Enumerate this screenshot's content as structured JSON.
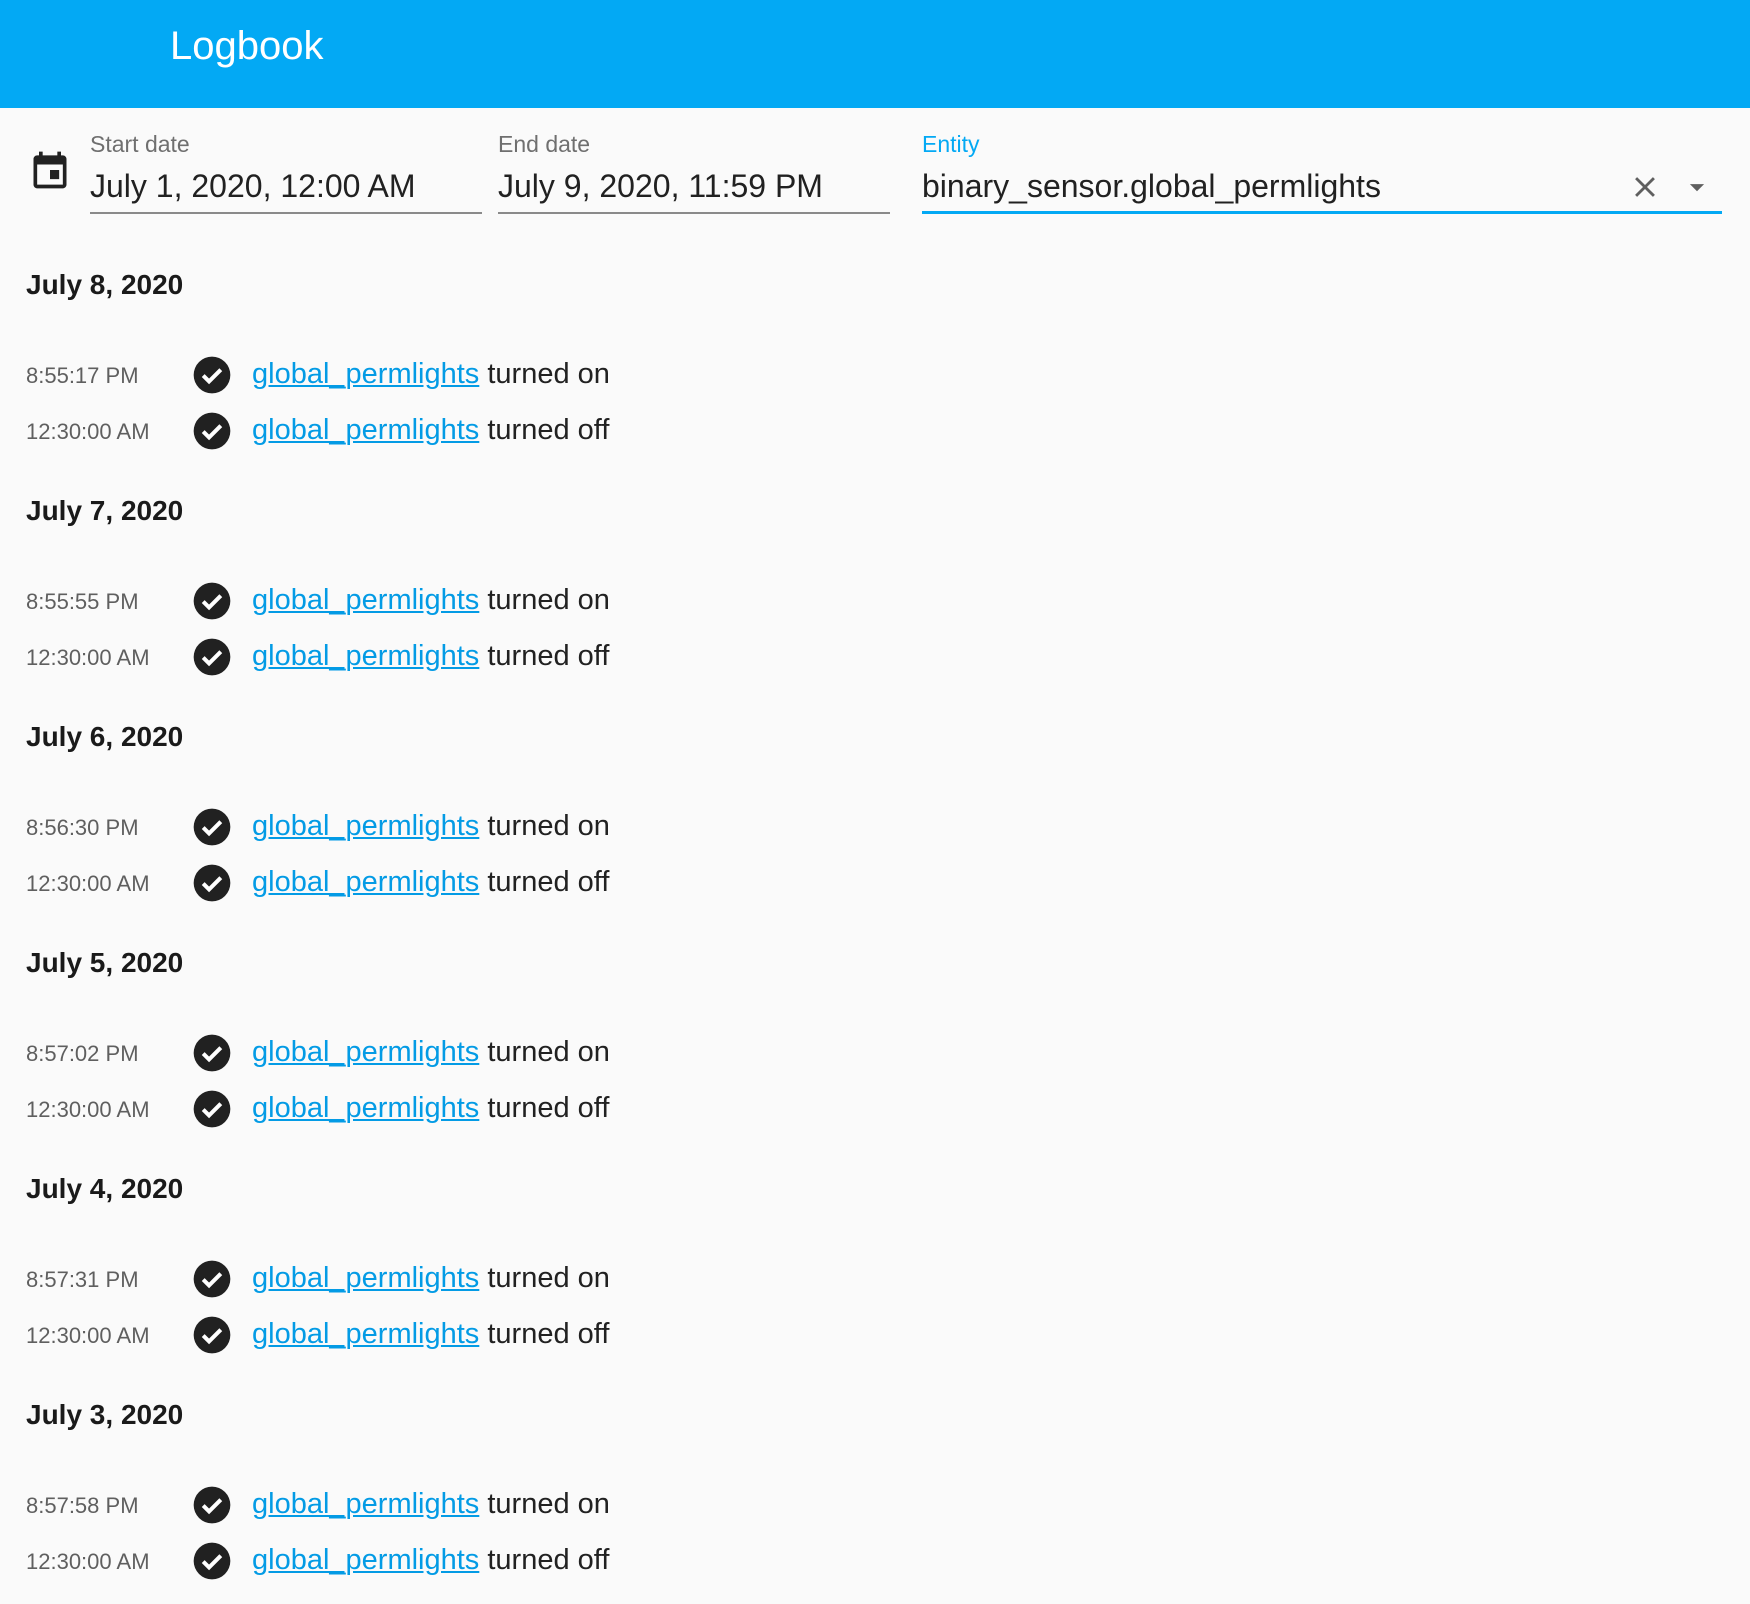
{
  "header": {
    "title": "Logbook"
  },
  "filters": {
    "start_date": {
      "label": "Start date",
      "value": "July 1, 2020, 12:00 AM"
    },
    "end_date": {
      "label": "End date",
      "value": "July 9, 2020, 11:59 PM"
    },
    "entity": {
      "label": "Entity",
      "value": "binary_sensor.global_permlights"
    }
  },
  "colors": {
    "accent": "#03a9f4",
    "link": "#039be5",
    "icon": "#212121"
  },
  "icons": {
    "calendar": "calendar-icon",
    "clear": "close-icon",
    "dropdown": "caret-down-icon",
    "entry": "check-circle-icon"
  },
  "log": [
    {
      "date": "July 8, 2020",
      "entries": [
        {
          "time": "8:55:17 PM",
          "entity": "global_permlights",
          "action": "turned on"
        },
        {
          "time": "12:30:00 AM",
          "entity": "global_permlights",
          "action": "turned off"
        }
      ]
    },
    {
      "date": "July 7, 2020",
      "entries": [
        {
          "time": "8:55:55 PM",
          "entity": "global_permlights",
          "action": "turned on"
        },
        {
          "time": "12:30:00 AM",
          "entity": "global_permlights",
          "action": "turned off"
        }
      ]
    },
    {
      "date": "July 6, 2020",
      "entries": [
        {
          "time": "8:56:30 PM",
          "entity": "global_permlights",
          "action": "turned on"
        },
        {
          "time": "12:30:00 AM",
          "entity": "global_permlights",
          "action": "turned off"
        }
      ]
    },
    {
      "date": "July 5, 2020",
      "entries": [
        {
          "time": "8:57:02 PM",
          "entity": "global_permlights",
          "action": "turned on"
        },
        {
          "time": "12:30:00 AM",
          "entity": "global_permlights",
          "action": "turned off"
        }
      ]
    },
    {
      "date": "July 4, 2020",
      "entries": [
        {
          "time": "8:57:31 PM",
          "entity": "global_permlights",
          "action": "turned on"
        },
        {
          "time": "12:30:00 AM",
          "entity": "global_permlights",
          "action": "turned off"
        }
      ]
    },
    {
      "date": "July 3, 2020",
      "entries": [
        {
          "time": "8:57:58 PM",
          "entity": "global_permlights",
          "action": "turned on"
        },
        {
          "time": "12:30:00 AM",
          "entity": "global_permlights",
          "action": "turned off"
        }
      ]
    }
  ]
}
